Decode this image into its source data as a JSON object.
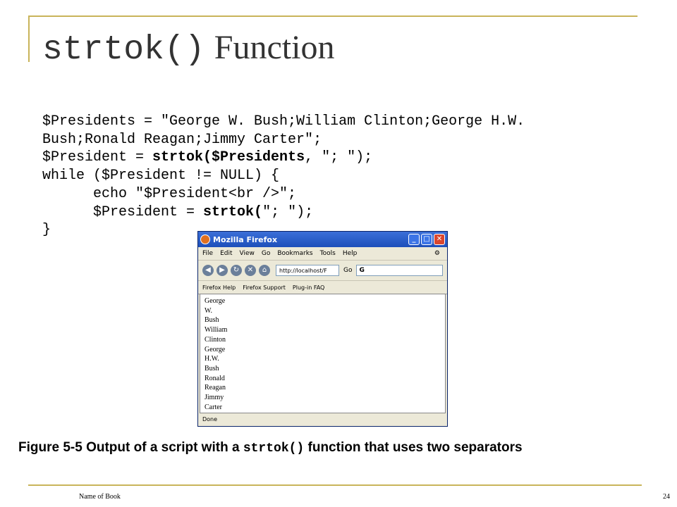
{
  "slide": {
    "title_code": "strtok()",
    "title_text": "Function",
    "code_lines": [
      [
        {
          "t": "$Presidents = \"George W. Bush;William Clinton;George H.W.",
          "b": false
        }
      ],
      [
        {
          "t": "Bush;Ronald Reagan;Jimmy Carter\";",
          "b": false
        }
      ],
      [
        {
          "t": "$President = ",
          "b": false
        },
        {
          "t": "strtok($Presidents",
          "b": true
        },
        {
          "t": ", \"; \");",
          "b": false
        }
      ],
      [
        {
          "t": "while ($President != NULL) {",
          "b": false
        }
      ],
      [
        {
          "t": "      echo \"$President<br />\";",
          "b": false
        }
      ],
      [
        {
          "t": "      $President = ",
          "b": false
        },
        {
          "t": "strtok(",
          "b": true
        },
        {
          "t": "\"; \");",
          "b": false
        }
      ],
      [
        {
          "t": "}",
          "b": false
        }
      ]
    ],
    "caption_prefix": "Figure 5-5  Output of a script with a ",
    "caption_code": "strtok()",
    "caption_suffix": " function that uses two separators",
    "footer_left": "Name of Book",
    "footer_right": "24"
  },
  "browser": {
    "title": "Mozilla Firefox",
    "menu": [
      "File",
      "Edit",
      "View",
      "Go",
      "Bookmarks",
      "Tools",
      "Help"
    ],
    "url": "http://localhost/F",
    "go_label": "Go",
    "search_text": "G",
    "bookmarks": [
      "Firefox Help",
      "Firefox Support",
      "Plug-in FAQ"
    ],
    "content_lines": [
      "George",
      "W.",
      "Bush",
      "William",
      "Clinton",
      "George",
      "H.W.",
      "Bush",
      "Ronald",
      "Reagan",
      "Jimmy",
      "Carter"
    ],
    "status": "Done"
  },
  "colors": {
    "rule": "#c9b45a",
    "title": "#333333"
  }
}
